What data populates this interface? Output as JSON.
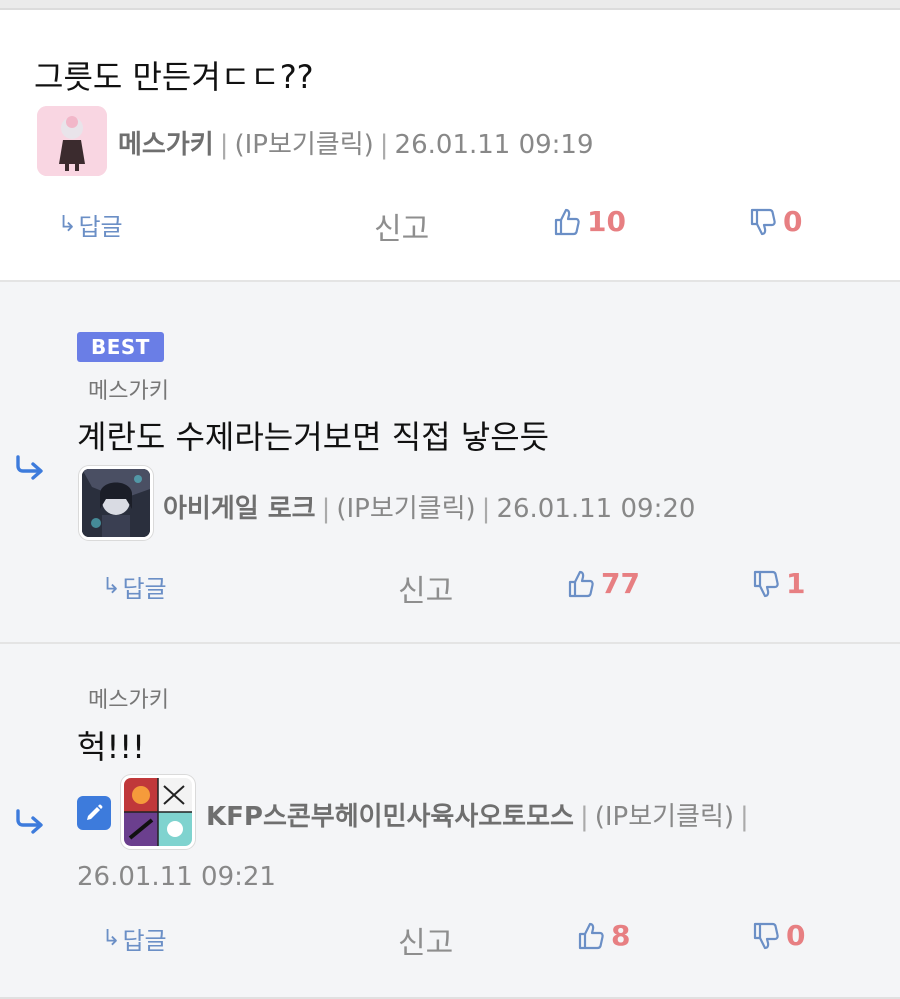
{
  "comments": [
    {
      "text": "그릇도 만든겨ㄷㄷ??",
      "nickname": "메스가키",
      "ip": "(IP보기클릭)",
      "date": "26.01.11 09:19",
      "reply_label": "답글",
      "report_label": "신고",
      "likes": "10",
      "dislikes": "0"
    },
    {
      "badge": "BEST",
      "mention": "메스가키",
      "text": "계란도 수제라는거보면 직접 낳은듯",
      "nickname": "아비게일 로크",
      "ip": "(IP보기클릭)",
      "date": "26.01.11 09:20",
      "reply_label": "답글",
      "report_label": "신고",
      "likes": "77",
      "dislikes": "1"
    },
    {
      "mention": "메스가키",
      "text": "헉!!!",
      "nickname": "KFP스콘부헤이민사육사오토모스",
      "ip": "(IP보기클릭)",
      "date": "26.01.11 09:21",
      "reply_label": "답글",
      "report_label": "신고",
      "likes": "8",
      "dislikes": "0"
    }
  ],
  "separator": "|",
  "colors": {
    "accent_blue": "#3d7bdc",
    "reply_blue": "#6b8fc6",
    "vote_red": "#e77f82",
    "best_badge": "#6a7ee6",
    "nested_bg": "#f4f5f7"
  },
  "icons": {
    "reply": "reply-arrow-icon",
    "like": "thumbs-up-icon",
    "dislike": "thumbs-down-icon",
    "edit": "pencil-icon"
  }
}
